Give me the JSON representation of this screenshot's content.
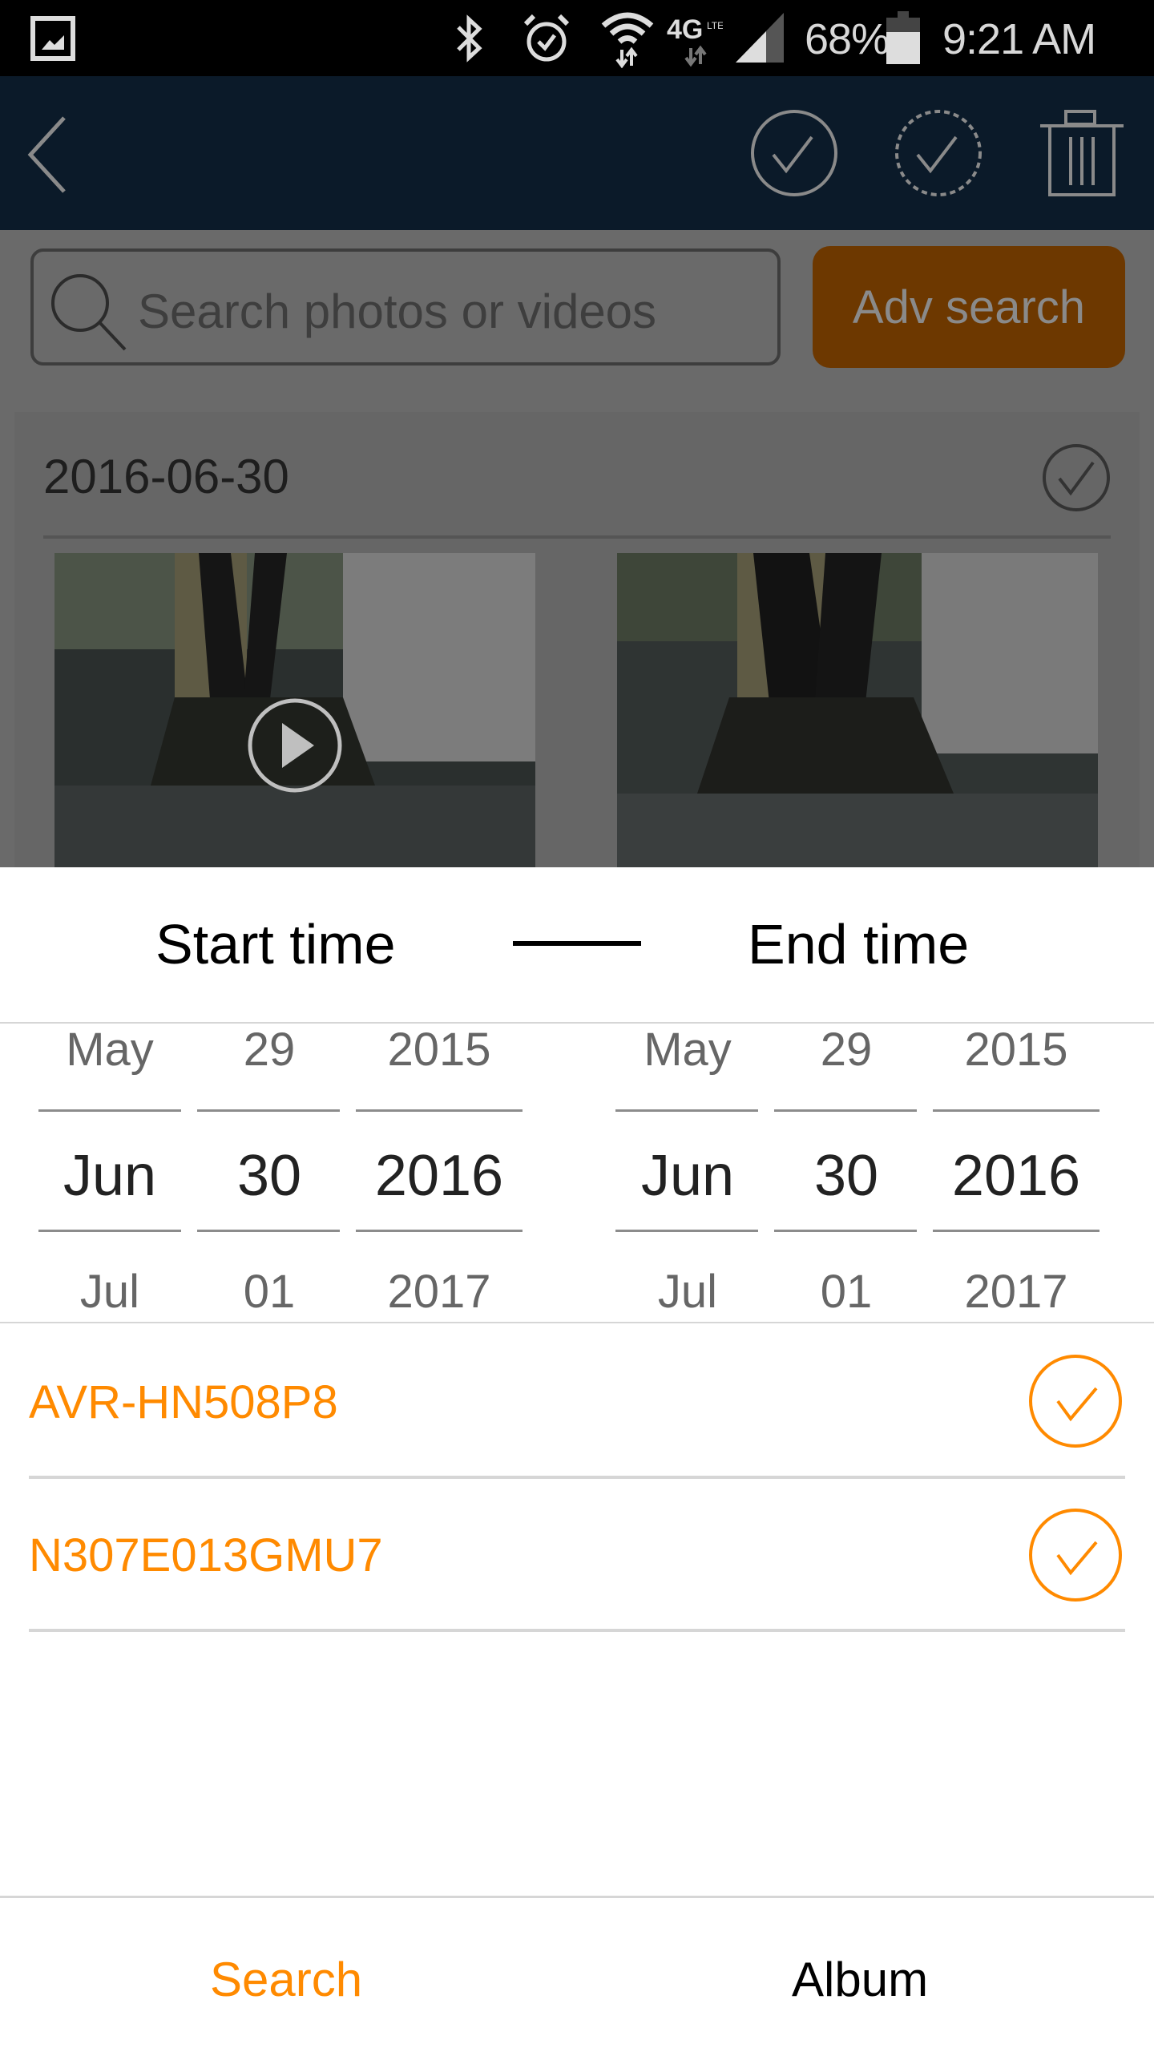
{
  "status_bar": {
    "battery": "68%",
    "time": "9:21 AM",
    "icons": [
      "gallery-notification-icon",
      "bluetooth-icon",
      "alarm-icon",
      "wifi-icon",
      "4g-lte-icon",
      "signal-icon",
      "battery-icon"
    ]
  },
  "header": {
    "back_icon": "chevron-left-icon",
    "actions": [
      "select-icon",
      "select-all-icon",
      "trash-icon"
    ]
  },
  "search": {
    "placeholder": "Search photos or videos",
    "adv_label": "Adv search"
  },
  "album": {
    "date": "2016-06-30",
    "thumbnails": [
      {
        "type": "video"
      },
      {
        "type": "photo"
      }
    ]
  },
  "time_picker": {
    "start_label": "Start time",
    "end_label": "End time",
    "start": {
      "month": {
        "prev": "May",
        "selected": "Jun",
        "next": "Jul"
      },
      "day": {
        "prev": "29",
        "selected": "30",
        "next": "01"
      },
      "year": {
        "prev": "2015",
        "selected": "2016",
        "next": "2017"
      }
    },
    "end": {
      "month": {
        "prev": "May",
        "selected": "Jun",
        "next": "Jul"
      },
      "day": {
        "prev": "29",
        "selected": "30",
        "next": "01"
      },
      "year": {
        "prev": "2015",
        "selected": "2016",
        "next": "2017"
      }
    }
  },
  "devices": [
    {
      "name": "AVR-HN508P8",
      "checked": true
    },
    {
      "name": "N307E013GMU7",
      "checked": true
    }
  ],
  "tabs": [
    {
      "label": "Search",
      "active": true
    },
    {
      "label": "Album",
      "active": false
    }
  ],
  "colors": {
    "accent": "#ff8a00",
    "header_bg": "#0b1a29"
  }
}
